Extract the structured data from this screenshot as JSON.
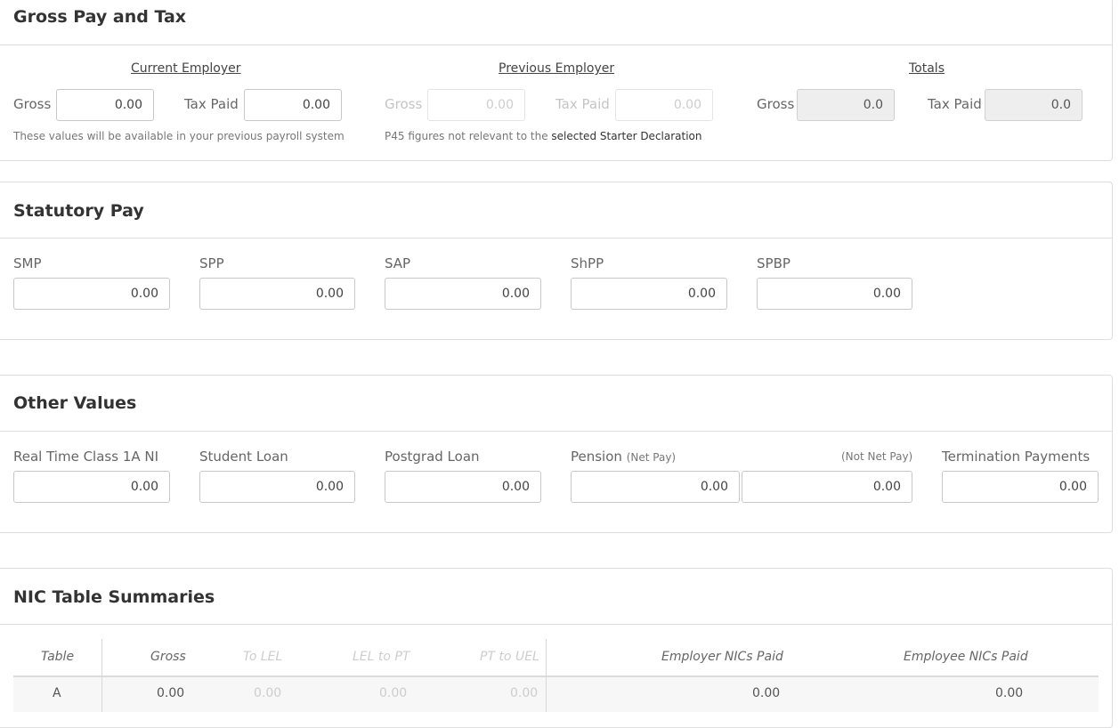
{
  "gross_pay_tax": {
    "title": "Gross Pay and Tax",
    "current_employer": {
      "header": "Current Employer",
      "gross_label": "Gross",
      "gross_value": "0.00",
      "tax_label": "Tax Paid",
      "tax_value": "0.00",
      "note": "These values will be available in your previous payroll system"
    },
    "previous_employer": {
      "header": "Previous Employer",
      "gross_label": "Gross",
      "gross_value": "0.00",
      "tax_label": "Tax Paid",
      "tax_value": "0.00",
      "note_prefix": "P45 figures not relevant to the ",
      "note_suffix": "selected Starter Declaration"
    },
    "totals": {
      "header": "Totals",
      "gross_label": "Gross",
      "gross_value": "0.0",
      "tax_label": "Tax Paid",
      "tax_value": "0.0"
    }
  },
  "statutory_pay": {
    "title": "Statutory Pay",
    "fields": [
      {
        "label": "SMP",
        "value": "0.00"
      },
      {
        "label": "SPP",
        "value": "0.00"
      },
      {
        "label": "SAP",
        "value": "0.00"
      },
      {
        "label": "ShPP",
        "value": "0.00"
      },
      {
        "label": "SPBP",
        "value": "0.00"
      }
    ]
  },
  "other_values": {
    "title": "Other Values",
    "real_time_label": "Real Time Class 1A NI",
    "real_time_value": "0.00",
    "student_loan_label": "Student Loan",
    "student_loan_value": "0.00",
    "postgrad_loan_label": "Postgrad Loan",
    "postgrad_loan_value": "0.00",
    "pension_label": "Pension",
    "pension_net_label": "(Net Pay)",
    "pension_net_value": "0.00",
    "pension_not_net_label": "(Not Net Pay)",
    "pension_not_net_value": "0.00",
    "termination_label": "Termination Payments",
    "termination_value": "0.00"
  },
  "nic_summaries": {
    "title": "NIC Table Summaries",
    "columns": [
      "Table",
      "Gross",
      "To LEL",
      "LEL to PT",
      "PT to UEL",
      "Employer NICs Paid",
      "Employee NICs Paid"
    ],
    "rows": [
      [
        "A",
        "0.00",
        "0.00",
        "0.00",
        "0.00",
        "0.00",
        "0.00"
      ]
    ]
  }
}
